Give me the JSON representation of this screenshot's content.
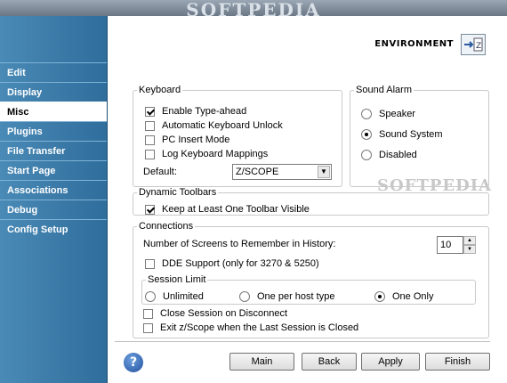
{
  "window": {
    "watermark_top": "SOFTPEDIA"
  },
  "sidebar": {
    "items": [
      {
        "label": "Edit"
      },
      {
        "label": "Display"
      },
      {
        "label": "Misc",
        "active": true
      },
      {
        "label": "Plugins"
      },
      {
        "label": "File Transfer"
      },
      {
        "label": "Start Page"
      },
      {
        "label": "Associations"
      },
      {
        "label": "Debug"
      },
      {
        "label": "Config Setup"
      }
    ]
  },
  "header": {
    "title": "ENVIRONMENT",
    "icon": "environment-icon"
  },
  "keyboard": {
    "legend": "Keyboard",
    "options": [
      {
        "label": "Enable Type-ahead",
        "checked": true
      },
      {
        "label": "Automatic Keyboard Unlock",
        "checked": false
      },
      {
        "label": "PC Insert Mode",
        "checked": false
      },
      {
        "label": "Log Keyboard Mappings",
        "checked": false
      }
    ],
    "default_label": "Default:",
    "default_value": "Z/SCOPE"
  },
  "sound_alarm": {
    "legend": "Sound Alarm",
    "options": [
      {
        "label": "Speaker",
        "selected": false
      },
      {
        "label": "Sound System",
        "selected": true
      },
      {
        "label": "Disabled",
        "selected": false
      }
    ]
  },
  "dynamic_toolbars": {
    "legend": "Dynamic Toolbars",
    "option": {
      "label": "Keep at Least One Toolbar Visible",
      "checked": true
    }
  },
  "connections": {
    "legend": "Connections",
    "screens_label": "Number of Screens to Remember in History:",
    "screens_value": "10",
    "dde_label": "DDE Support (only for 3270 & 5250)",
    "dde_checked": false,
    "session_limit": {
      "legend": "Session Limit",
      "options": [
        {
          "label": "Unlimited",
          "selected": false
        },
        {
          "label": "One per host type",
          "selected": false
        },
        {
          "label": "One Only",
          "selected": true
        }
      ]
    },
    "close_session_label": "Close Session on Disconnect",
    "exit_label": "Exit z/Scope when the Last Session is Closed"
  },
  "footer": {
    "help": "?",
    "buttons": {
      "main": "Main",
      "back": "Back",
      "apply": "Apply",
      "finish": "Finish"
    }
  },
  "watermark_mid": "SOFTPEDIA"
}
